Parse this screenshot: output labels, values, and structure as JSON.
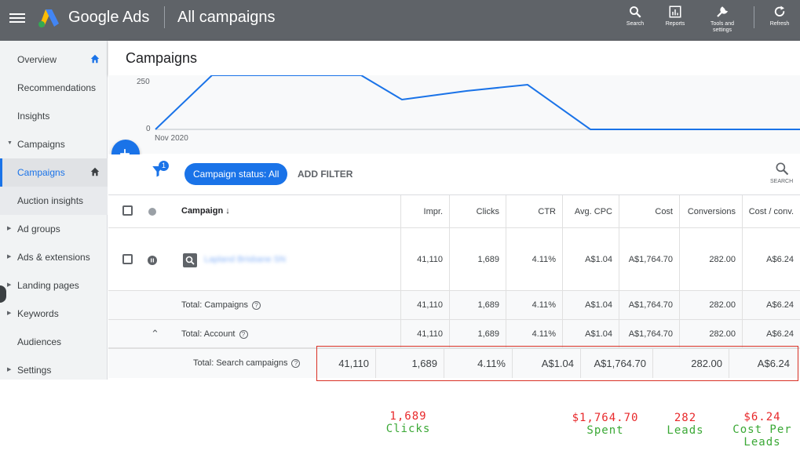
{
  "topbar": {
    "brand": "Google Ads",
    "page": "All campaigns",
    "tools": [
      {
        "label": "Search",
        "icon": "search-icon"
      },
      {
        "label": "Reports",
        "icon": "reports-icon"
      },
      {
        "label": "Tools and settings",
        "icon": "wrench-icon"
      },
      {
        "label": "Refresh",
        "icon": "refresh-icon"
      }
    ]
  },
  "sidebar": {
    "items": [
      {
        "label": "Overview",
        "icon": "home-icon"
      },
      {
        "label": "Recommendations"
      },
      {
        "label": "Insights"
      },
      {
        "label": "Campaigns",
        "expanded": true
      },
      {
        "label": "Campaigns",
        "active": true,
        "icon": "home-icon"
      },
      {
        "label": "Auction insights"
      },
      {
        "label": "Ad groups"
      },
      {
        "label": "Ads & extensions"
      },
      {
        "label": "Landing pages"
      },
      {
        "label": "Keywords"
      },
      {
        "label": "Audiences"
      },
      {
        "label": "Settings"
      }
    ]
  },
  "content": {
    "title": "Campaigns",
    "chart": {
      "y_ticks": [
        "250",
        "0"
      ],
      "x_label": "Nov 2020"
    },
    "filter": {
      "badge": "1",
      "chip": "Campaign status: All",
      "add_filter": "ADD FILTER",
      "search": "SEARCH"
    }
  },
  "table": {
    "columns": {
      "campaign": "Campaign",
      "impr": "Impr.",
      "clicks": "Clicks",
      "ctr": "CTR",
      "avg_cpc": "Avg. CPC",
      "cost": "Cost",
      "conversions": "Conversions",
      "cost_conv": "Cost / conv."
    },
    "campaign_row": {
      "name": "Lapland Brisbane SN",
      "impr": "41,110",
      "clicks": "1,689",
      "ctr": "4.11%",
      "avg_cpc": "A$1.04",
      "cost": "A$1,764.70",
      "conversions": "282.00",
      "cost_conv": "A$6.24"
    },
    "total_campaigns": {
      "label": "Total: Campaigns",
      "impr": "41,110",
      "clicks": "1,689",
      "ctr": "4.11%",
      "avg_cpc": "A$1.04",
      "cost": "A$1,764.70",
      "conversions": "282.00",
      "cost_conv": "A$6.24"
    },
    "total_account": {
      "label": "Total: Account",
      "impr": "41,110",
      "clicks": "1,689",
      "ctr": "4.11%",
      "avg_cpc": "A$1.04",
      "cost": "A$1,764.70",
      "conversions": "282.00",
      "cost_conv": "A$6.24"
    },
    "total_search": {
      "label": "Total: Search campaigns",
      "impr": "41,110",
      "clicks": "1,689",
      "ctr": "4.11%",
      "avg_cpc": "A$1.04",
      "cost": "A$1,764.70",
      "conversions": "282.00",
      "cost_conv": "A$6.24"
    }
  },
  "annotations": {
    "clicks": {
      "value": "1,689",
      "label": "Clicks"
    },
    "spent": {
      "value": "$1,764.70",
      "label": "Spent"
    },
    "leads": {
      "value": "282",
      "label": "Leads"
    },
    "cpl": {
      "value": "$6.24",
      "label1": "Cost Per",
      "label2": "Leads"
    }
  },
  "colors": {
    "accent": "#1a73e8",
    "highlight": "#d93025",
    "annot_value": "#e8292b",
    "annot_label": "#3aa835"
  }
}
